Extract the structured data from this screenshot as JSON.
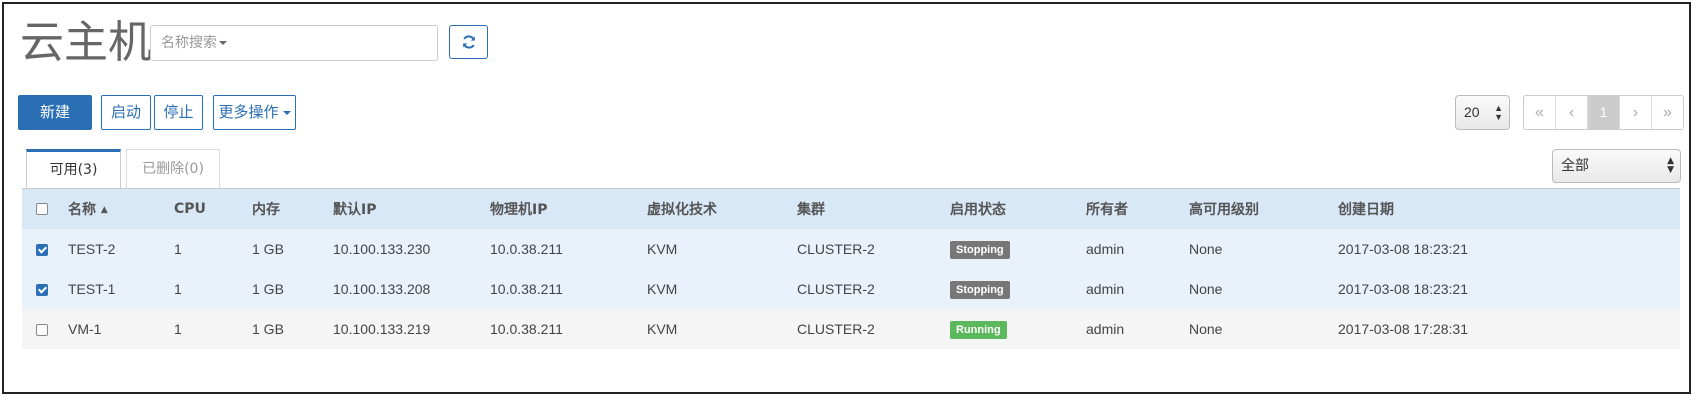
{
  "page": {
    "title": "云主机"
  },
  "search": {
    "placeholder": "名称搜索"
  },
  "toolbar": {
    "new_label": "新建",
    "start_label": "启动",
    "stop_label": "停止",
    "more_label": "更多操作"
  },
  "pagination": {
    "page_size": "20",
    "first": "«",
    "prev": "‹",
    "current": "1",
    "next": "›",
    "last": "»"
  },
  "tabs": [
    {
      "label": "可用(3)",
      "active": true
    },
    {
      "label": "已删除(0)",
      "active": false
    }
  ],
  "filter": {
    "selected": "全部"
  },
  "table": {
    "headers": [
      "名称",
      "CPU",
      "内存",
      "默认IP",
      "物理机IP",
      "虚拟化技术",
      "集群",
      "启用状态",
      "所有者",
      "高可用级别",
      "创建日期"
    ],
    "rows": [
      {
        "checked": true,
        "name": "TEST-2",
        "cpu": "1",
        "memory": "1 GB",
        "ip": "10.100.133.230",
        "host_ip": "10.0.38.211",
        "hypervisor": "KVM",
        "cluster": "CLUSTER-2",
        "state": "Stopping",
        "owner": "admin",
        "ha": "None",
        "created": "2017-03-08 18:23:21"
      },
      {
        "checked": true,
        "name": "TEST-1",
        "cpu": "1",
        "memory": "1 GB",
        "ip": "10.100.133.208",
        "host_ip": "10.0.38.211",
        "hypervisor": "KVM",
        "cluster": "CLUSTER-2",
        "state": "Stopping",
        "owner": "admin",
        "ha": "None",
        "created": "2017-03-08 18:23:21"
      },
      {
        "checked": false,
        "name": "VM-1",
        "cpu": "1",
        "memory": "1 GB",
        "ip": "10.100.133.219",
        "host_ip": "10.0.38.211",
        "hypervisor": "KVM",
        "cluster": "CLUSTER-2",
        "state": "Running",
        "owner": "admin",
        "ha": "None",
        "created": "2017-03-08 17:28:31"
      }
    ]
  },
  "colors": {
    "accent": "#2a6eb4",
    "stopping": "#777777",
    "running": "#5cb85c"
  },
  "icons": {
    "refresh": "refresh-icon",
    "sort": "sort-asc-icon",
    "dropdown": "caret-down-icon"
  }
}
